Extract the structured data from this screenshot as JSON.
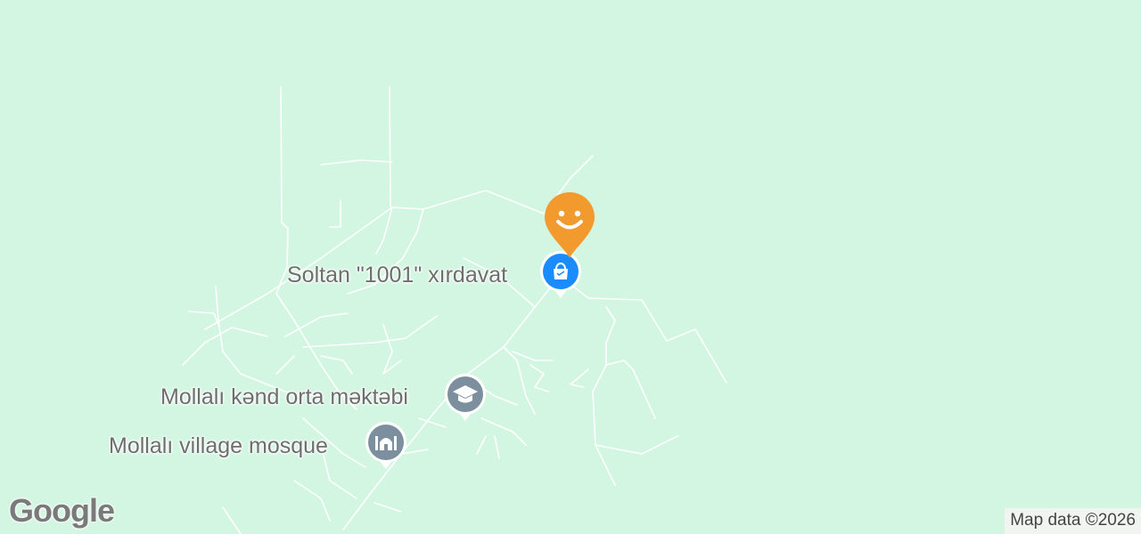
{
  "map": {
    "background_color": "#d3f6e2",
    "road_color": "#ffffff"
  },
  "pois": [
    {
      "id": "soltan",
      "label": "Soltan \"1001\" xırdavat",
      "icon": "shopping-bag-icon",
      "color": "#1a8cff"
    },
    {
      "id": "school",
      "label": "Mollalı kənd orta məktəbi",
      "icon": "school-cap-icon",
      "color": "#7c8f9e"
    },
    {
      "id": "mosque",
      "label": "Mollalı village mosque",
      "icon": "mosque-icon",
      "color": "#7c8f9e"
    }
  ],
  "user_marker": {
    "icon": "smiley-marker-icon",
    "color": "#f29a2e"
  },
  "branding": {
    "logo_text": "Google"
  },
  "attribution": {
    "text": "Map data ©2026"
  }
}
